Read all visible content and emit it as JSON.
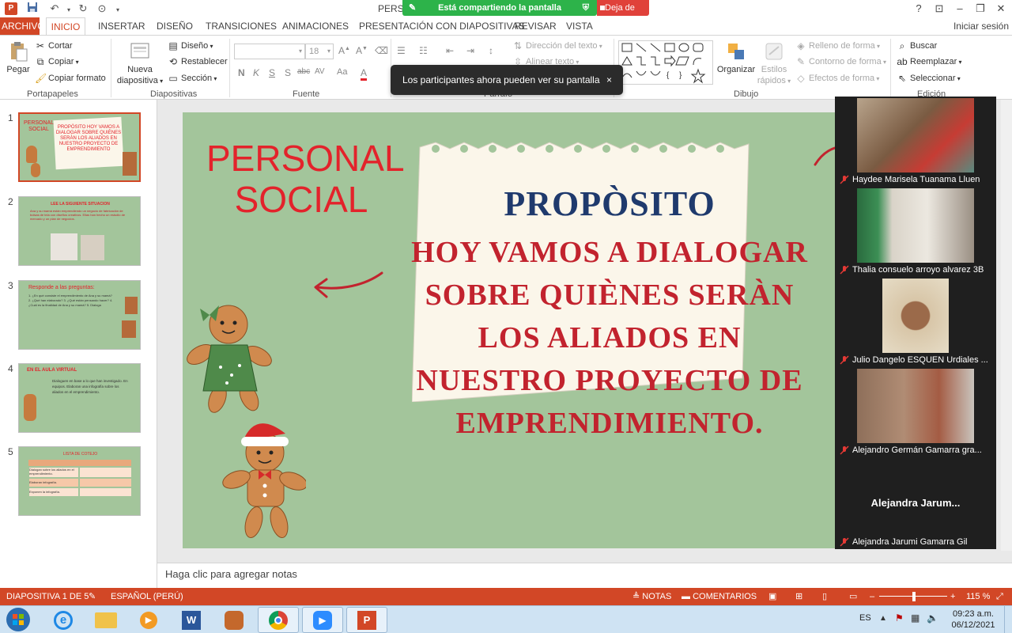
{
  "titlebar": {
    "doc_title": "PERSO",
    "sharing_text": "Está compartiendo la pantalla",
    "stop_share": "Deja de",
    "help": "?"
  },
  "tabs": [
    "ARCHIVO",
    "INICIO",
    "INSERTAR",
    "DISEÑO",
    "TRANSICIONES",
    "ANIMACIONES",
    "PRESENTACIÓN CON DIAPOSITIVAS",
    "REVISAR",
    "VISTA"
  ],
  "signin": "Iniciar sesión",
  "ribbon": {
    "clipboard": {
      "paste": "Pegar",
      "cut": "Cortar",
      "copy": "Copiar",
      "format_painter": "Copiar formato",
      "label": "Portapapeles"
    },
    "slides": {
      "new_slide_1": "Nueva",
      "new_slide_2": "diapositiva",
      "layout": "Diseño",
      "reset": "Restablecer",
      "section": "Sección",
      "label": "Diapositivas"
    },
    "font": {
      "size": "18",
      "label": "Fuente"
    },
    "paragraph": {
      "text_direction": "Dirección del texto",
      "align_text": "Alinear texto",
      "label": "Párrafo"
    },
    "drawing": {
      "arrange": "Organizar",
      "quick_styles_1": "Estilos",
      "quick_styles_2": "rápidos",
      "shape_fill": "Relleno de forma",
      "shape_outline": "Contorno de forma",
      "shape_effects": "Efectos de forma",
      "label": "Dibujo"
    },
    "editing": {
      "find": "Buscar",
      "replace": "Reemplazar",
      "select": "Seleccionar",
      "label": "Edición"
    }
  },
  "toast": {
    "text": "Los participantes ahora pueden ver su pantalla",
    "close": "×"
  },
  "thumbnails": [
    {
      "num": "1",
      "title": "PERSONAL SOCIAL",
      "text": "PROPÒSITO HOY VAMOS A DIALOGAR SOBRE QUIÈNES SERÀN LOS ALIADOS EN NUESTRO PROYECTO DE EMPRENDIMIENTO"
    },
    {
      "num": "2",
      "title": "LEE LA SIGUIENTE SITUACION",
      "text": "Ana y su mamá están emprendiendo un negocio de fabricación de bolsas de tela con diseños creativos. Ellas han hecho un estudio de mercado y un plan de negocios."
    },
    {
      "num": "3",
      "title": "Responde a las preguntas:",
      "text": "1. ¿En qué consiste el emprendimiento de Ana y su mamá? 2. ¿Qué han elaborado? 3. ¿Qué están pensando hacer? 4. ¿Cuál es la finalidad de Ana y su mamá? 5. Dialoga"
    },
    {
      "num": "4",
      "title": "EN EL AULA VIRTUAL",
      "text": "Dialoguen en base a lo que han investigado. En equipos. Elaboran una infografía sobre los aliados en el emprendimiento."
    },
    {
      "num": "5",
      "title": "LISTA DE COTEJO",
      "rows": [
        "Dialogan sobre los aliados en el emprendimiento.",
        "Elaboran infografía.",
        "Exponen la infografía."
      ]
    }
  ],
  "slide": {
    "subject_line1": "PERSONAL",
    "subject_line2": "SOCIAL",
    "purpose_title": "PROPÒSITO",
    "purpose_lines": [
      "HOY VAMOS A DIALOGAR",
      "SOBRE QUIÈNES SERÀN",
      "LOS ALIADOS EN",
      "NUESTRO PROYECTO DE",
      "EMPRENDIMIENTO."
    ]
  },
  "notes_placeholder": "Haga clic para agregar notas",
  "participants": [
    {
      "name": "Haydee Marisela Tuanama Lluen"
    },
    {
      "name": "Thalia consuelo arroyo alvarez 3B"
    },
    {
      "name": "Julio Dangelo ESQUEN Urdiales ..."
    },
    {
      "name": "Alejandro Germán Gamarra  gra..."
    },
    {
      "name": "Alejandra Jarumi Gamarra Gil"
    }
  ],
  "participant_big_name": "Alejandra  Jarum...",
  "status": {
    "slide_info": "DIAPOSITIVA 1 DE 5",
    "language": "ESPAÑOL (PERÚ)",
    "notes": "NOTAS",
    "comments": "COMENTARIOS",
    "zoom": "115 %"
  },
  "taskbar": {
    "lang": "ES",
    "time": "09:23 a.m.",
    "date": "06/12/2021"
  },
  "colors": {
    "accent": "#d24726",
    "slide_bg": "#a3c59b",
    "slide_red": "#e3232b",
    "slide_blue": "#1f3a6d",
    "share_green": "#2db34a"
  }
}
